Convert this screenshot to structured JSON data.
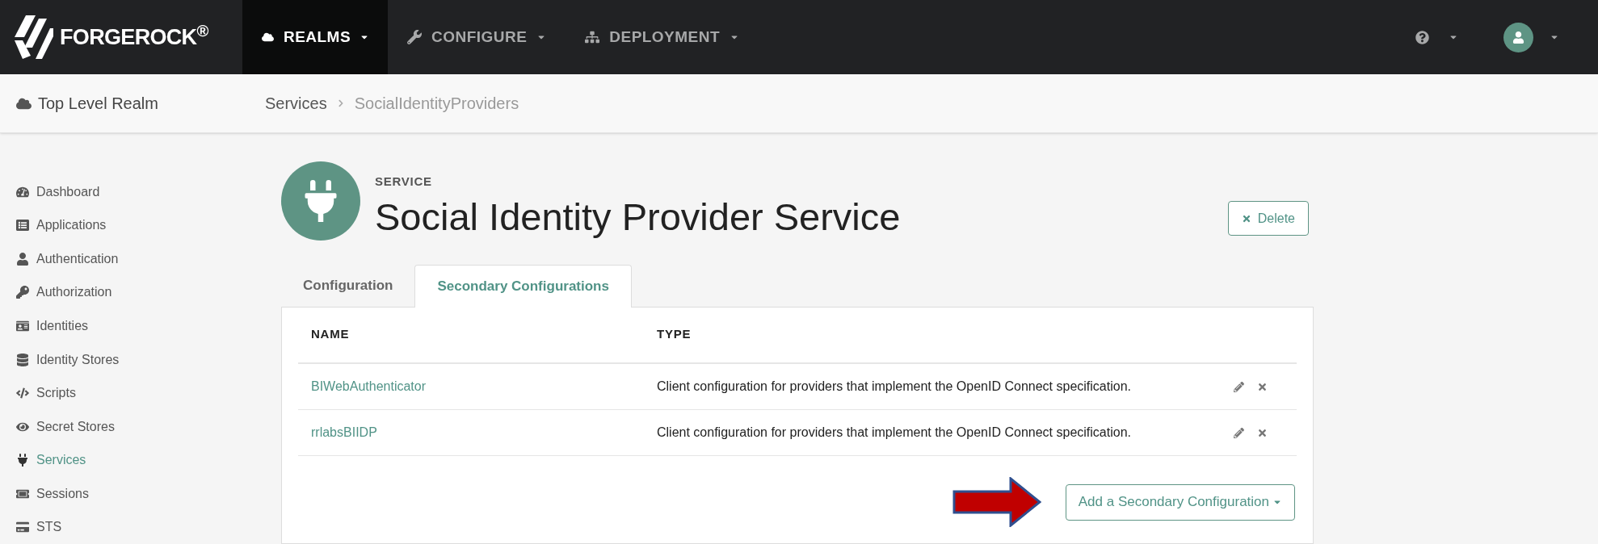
{
  "nav": {
    "brand": "FORGEROCK$^{®}$",
    "items": [
      {
        "label": "REALMS",
        "selected": true
      },
      {
        "label": "CONFIGURE",
        "selected": false
      },
      {
        "label": "DEPLOYMENT",
        "selected": false
      }
    ]
  },
  "breadcrumb_bar": {
    "realm": "Top Level Realm",
    "path": [
      "Services",
      "SocialIdentityProviders"
    ]
  },
  "sidebar": {
    "items": [
      {
        "label": "Dashboard",
        "selected": false
      },
      {
        "label": "Applications",
        "selected": false
      },
      {
        "label": "Authentication",
        "selected": false
      },
      {
        "label": "Authorization",
        "selected": false
      },
      {
        "label": "Identities",
        "selected": false
      },
      {
        "label": "Identity Stores",
        "selected": false
      },
      {
        "label": "Scripts",
        "selected": false
      },
      {
        "label": "Secret Stores",
        "selected": false
      },
      {
        "label": "Services",
        "selected": true
      },
      {
        "label": "Sessions",
        "selected": false
      },
      {
        "label": "STS",
        "selected": false
      }
    ]
  },
  "header": {
    "eyebrow": "SERVICE",
    "title": "Social Identity Provider Service",
    "delete_button": "Delete"
  },
  "tabs": [
    {
      "label": "Configuration",
      "selected": false
    },
    {
      "label": "Secondary Configurations",
      "selected": true
    }
  ],
  "table": {
    "columns": [
      "NAME",
      "TYPE"
    ],
    "rows": [
      {
        "name": "BIWebAuthenticator",
        "type": "Client configuration for providers that implement the OpenID Connect specification."
      },
      {
        "name": "rrlabsBIIDP",
        "type": "Client configuration for providers that implement the OpenID Connect specification."
      }
    ]
  },
  "add_button": "Add a Secondary Configuration"
}
